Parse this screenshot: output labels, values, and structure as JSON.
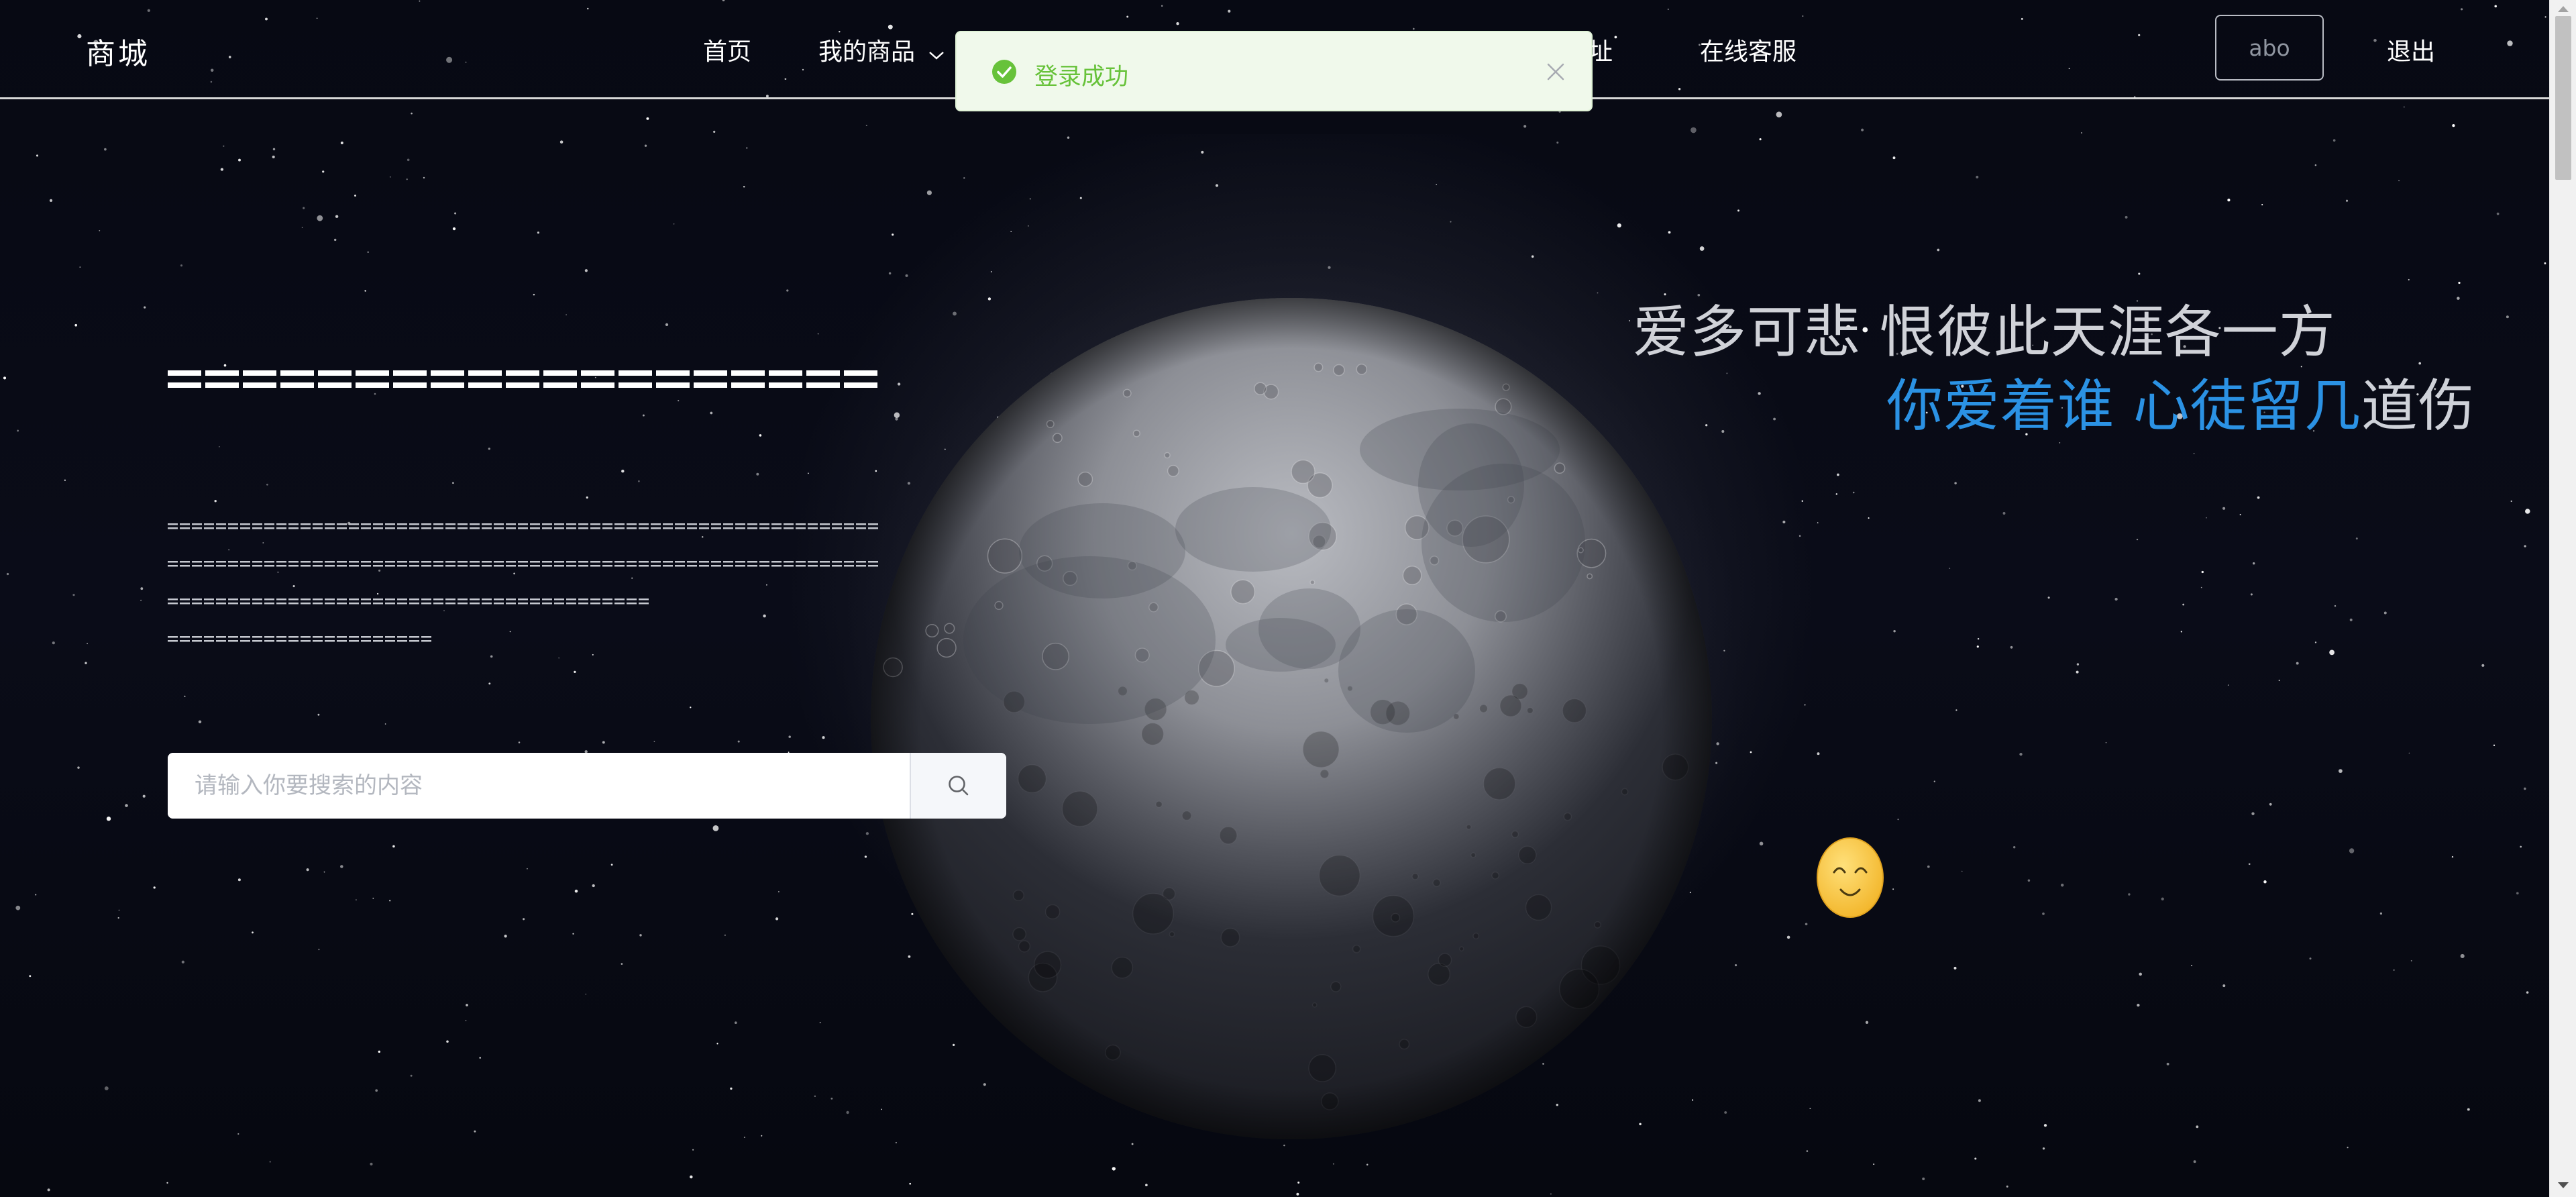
{
  "header": {
    "brand": "商城",
    "nav": [
      {
        "label": "首页"
      },
      {
        "label": "我的商品"
      },
      {
        "label": "地址"
      },
      {
        "label": "在线客服"
      }
    ],
    "username": "abo",
    "logout_label": "退出"
  },
  "toast": {
    "message": "登录成功",
    "type": "success",
    "icon": "check-circle-icon",
    "close_icon": "close-icon"
  },
  "hero": {
    "search": {
      "placeholder": "请输入你要搜索的内容",
      "value": "",
      "icon": "search-icon"
    }
  },
  "poem": {
    "line1": "爱多可悲 恨彼此天涯各一方",
    "line2_highlight": "你爱着谁 心徒留几",
    "line2_rest": "道伤"
  },
  "colors": {
    "highlight": "#2b92e4",
    "success": "#67c23a",
    "success_bg": "#f0f9eb"
  }
}
